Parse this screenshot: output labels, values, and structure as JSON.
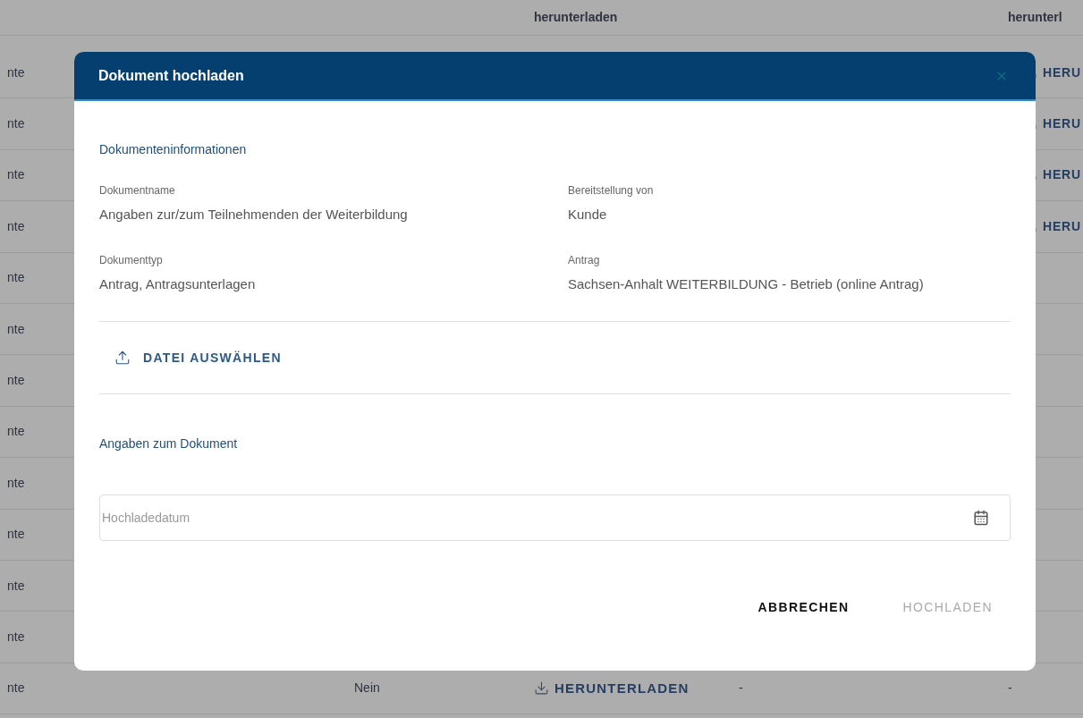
{
  "table": {
    "header": {
      "column_3": "herunterladen",
      "column_5": "herunterl"
    },
    "rows": [
      {
        "column_1": {
          "kind": "text",
          "text": "nte"
        },
        "column_5": {
          "kind": "download",
          "text": "HERU"
        }
      },
      {
        "column_1": {
          "kind": "text",
          "text": "nte"
        },
        "column_5": {
          "kind": "download",
          "text": "HERU"
        }
      },
      {
        "column_1": {
          "kind": "text",
          "text": "nte"
        },
        "column_5": {
          "kind": "download",
          "text": "HERU"
        }
      },
      {
        "column_1": {
          "kind": "text",
          "text": "nte"
        },
        "column_5": {
          "kind": "download",
          "text": "HERU"
        }
      },
      {
        "column_1": {
          "kind": "text",
          "text": "nte"
        }
      },
      {
        "column_1": {
          "kind": "text",
          "text": "nte"
        }
      },
      {
        "column_1": {
          "kind": "text",
          "text": "nte"
        }
      },
      {
        "column_1": {
          "kind": "text",
          "text": "nte"
        }
      },
      {
        "column_1": {
          "kind": "text",
          "text": "nte"
        }
      },
      {
        "column_1": {
          "kind": "text",
          "text": "nte"
        }
      },
      {
        "column_1": {
          "kind": "text",
          "text": "nte"
        }
      },
      {
        "column_1": {
          "kind": "text",
          "text": "nte"
        }
      },
      {
        "column_1": {
          "kind": "text",
          "text": "nte"
        },
        "column_2": {
          "kind": "text",
          "text": "Nein"
        },
        "column_3": {
          "kind": "download",
          "text": "HERUNTERLADEN"
        },
        "column_4": {
          "kind": "text",
          "text": "-"
        },
        "column_5": {
          "kind": "text",
          "text": "-"
        }
      }
    ]
  },
  "dialog": {
    "title": "Dokument hochladen",
    "info_title": "Dokumenteninformationen",
    "fields": [
      {
        "label": "Dokumentname",
        "value": "Angaben zur/zum Teilnehmenden der Weiterbildung"
      },
      {
        "label": "Bereitstellung von",
        "value": "Kunde"
      },
      {
        "label": "Dokumenttyp",
        "value": "Antrag, Antragsunterlagen"
      },
      {
        "label": "Antrag",
        "value": "Sachsen-Anhalt WEITERBILDUNG - Betrieb (online Antrag)"
      }
    ],
    "file_button": "DATEI AUSWÄHLEN",
    "details_title": "Angaben zum Dokument",
    "date_field": {
      "placeholder": "Hochladedatum"
    },
    "buttons": [
      {
        "label": "ABBRECHEN",
        "disabled": false
      },
      {
        "label": "HOCHLADEN",
        "disabled": true
      }
    ]
  }
}
